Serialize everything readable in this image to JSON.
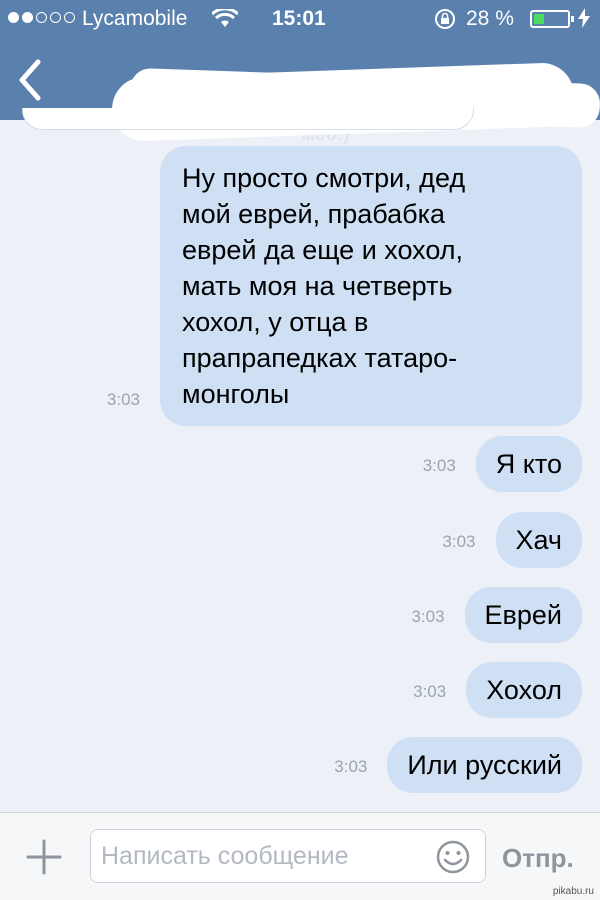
{
  "status_bar": {
    "carrier": "Lycamobile",
    "time": "15:01",
    "battery_percent": "28 %",
    "battery_level": 0.28,
    "signal_bars_filled": 2,
    "signal_bars_total": 5
  },
  "nav": {
    "subtitle_fragment": "моо.)"
  },
  "messages": [
    {
      "time": "3:03",
      "text": "Ну просто смотри, дед\nмой еврей, прабабка\nеврей да еще и хохол,\nмать моя на четверть\nхохол, у отца в\nпрапрапедках татаро-\nмонголы"
    },
    {
      "time": "3:03",
      "text": "Я кто"
    },
    {
      "time": "3:03",
      "text": "Хач"
    },
    {
      "time": "3:03",
      "text": "Еврей"
    },
    {
      "time": "3:03",
      "text": "Хохол"
    },
    {
      "time": "3:03",
      "text": "Или русский"
    }
  ],
  "composer": {
    "placeholder": "Написать сообщение",
    "send_label": "Отпр."
  },
  "watermark": "pikabu.ru",
  "colors": {
    "header": "#5a81ad",
    "bubble": "#cfe0f5",
    "background": "#edf1f7"
  }
}
